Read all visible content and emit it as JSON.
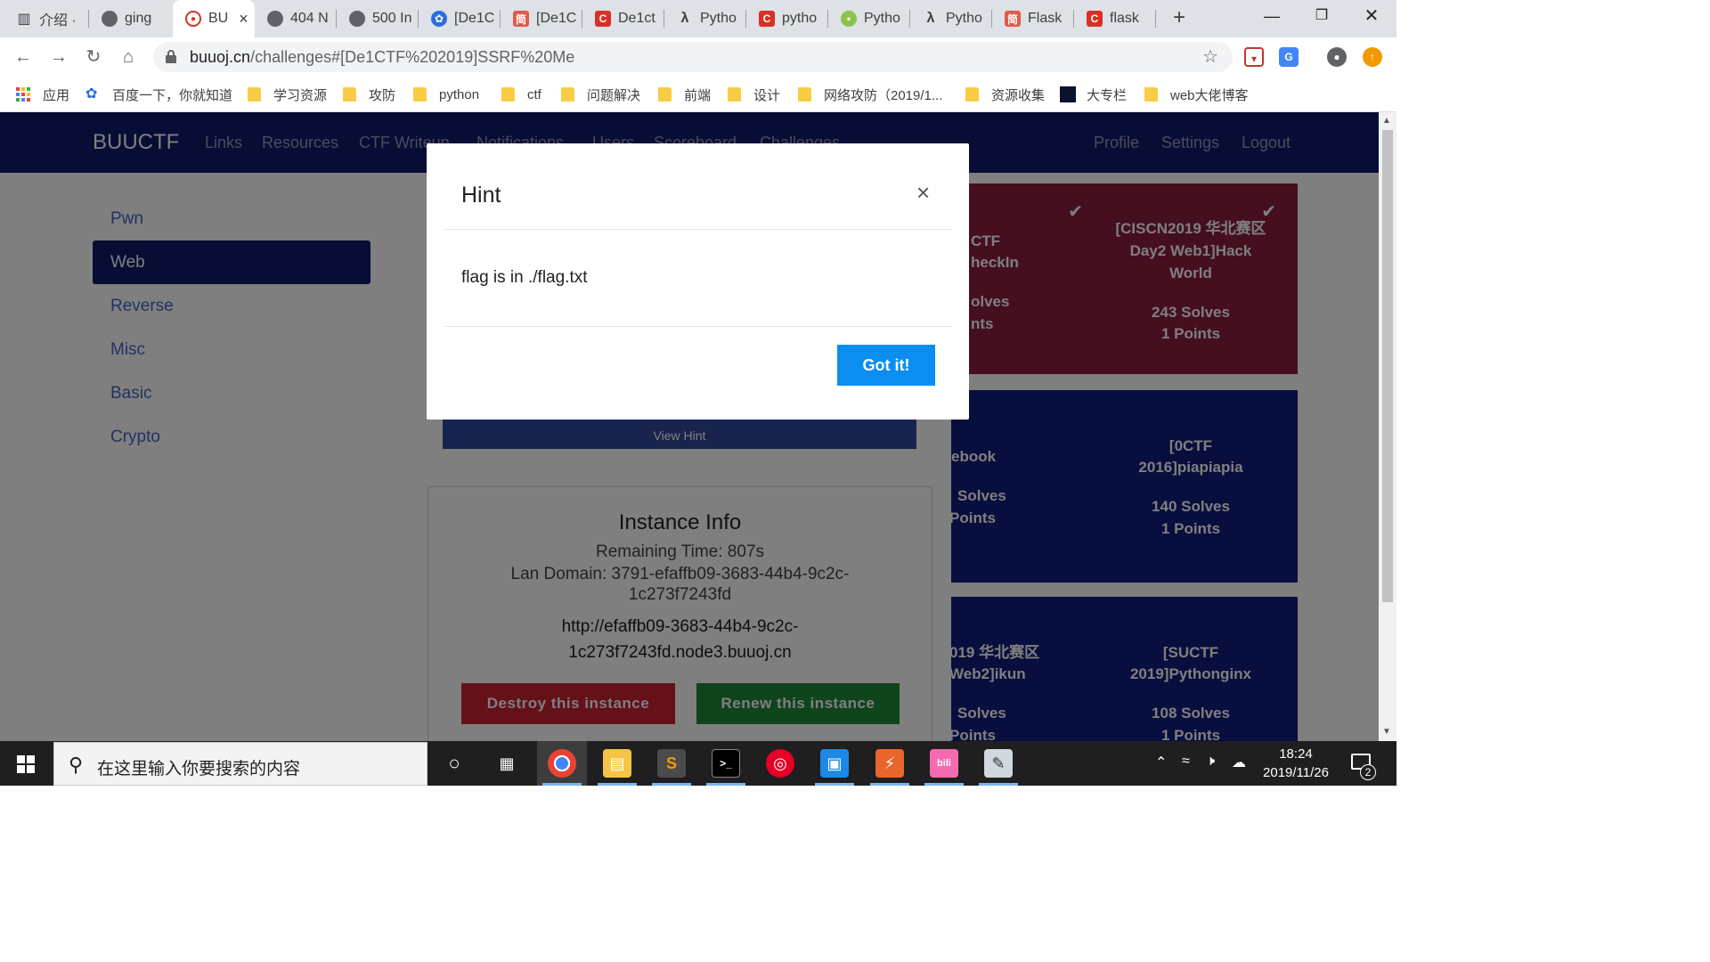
{
  "browser": {
    "tabs": [
      {
        "label": "介绍 ·",
        "icon": "book-icon"
      },
      {
        "label": "ging",
        "icon": "globe-icon"
      },
      {
        "label": "BU",
        "icon": "buuctf-icon",
        "active": true
      },
      {
        "label": "404 N",
        "icon": "globe-icon"
      },
      {
        "label": "500 In",
        "icon": "globe-icon"
      },
      {
        "label": "[De1C",
        "icon": "baidu-icon"
      },
      {
        "label": "[De1C",
        "icon": "jianshu-icon"
      },
      {
        "label": "De1ct",
        "icon": "csdn-icon"
      },
      {
        "label": "Pytho",
        "icon": "lambda-icon"
      },
      {
        "label": "pytho",
        "icon": "csdn-icon"
      },
      {
        "label": "Pytho",
        "icon": "chat-icon"
      },
      {
        "label": "Pytho",
        "icon": "lambda-icon"
      },
      {
        "label": "Flask",
        "icon": "jianshu-icon"
      },
      {
        "label": "flask",
        "icon": "csdn-icon"
      }
    ],
    "tab_close": "×",
    "new_tab": "+",
    "url_host": "buuoj.cn",
    "url_path": "/challenges#[De1CTF%202019]SSRF%20Me",
    "bookmarks": [
      {
        "label": "应用",
        "type": "apps"
      },
      {
        "label": "百度一下，你就知道",
        "type": "baidu"
      },
      {
        "label": "学习资源",
        "type": "folder"
      },
      {
        "label": "攻防",
        "type": "folder"
      },
      {
        "label": "python",
        "type": "folder"
      },
      {
        "label": "ctf",
        "type": "folder"
      },
      {
        "label": "问题解决",
        "type": "folder"
      },
      {
        "label": "前端",
        "type": "folder"
      },
      {
        "label": "设计",
        "type": "folder"
      },
      {
        "label": "网络攻防（2019/1...",
        "type": "folder"
      },
      {
        "label": "资源收集",
        "type": "folder"
      },
      {
        "label": "大专栏",
        "type": "dark"
      },
      {
        "label": "web大佬博客",
        "type": "folder"
      }
    ]
  },
  "site": {
    "brand": "BUUCTF",
    "nav_left": [
      "Links",
      "Resources",
      "CTF Writeup",
      "Notifications",
      "Users",
      "Scoreboard",
      "Challenges"
    ],
    "nav_right": [
      "Profile",
      "Settings",
      "Logout"
    ],
    "categories": [
      {
        "label": "Pwn",
        "active": false
      },
      {
        "label": "Web",
        "active": true
      },
      {
        "label": "Reverse",
        "active": false
      },
      {
        "label": "Misc",
        "active": false
      },
      {
        "label": "Basic",
        "active": false
      },
      {
        "label": "Crypto",
        "active": false
      }
    ],
    "view_hint": "View Hint",
    "instance": {
      "title": "Instance Info",
      "remaining": "Remaining Time: 807s",
      "lan_domain_1": "Lan Domain: 3791-efaffb09-3683-44b4-9c2c-",
      "lan_domain_2": "1c273f7243fd",
      "url_1": "http://efaffb09-3683-44b4-9c2c-",
      "url_2": "1c273f7243fd.node3.buuoj.cn",
      "destroy": "Destroy this instance",
      "renew": "Renew this instance"
    },
    "cards": [
      {
        "title_1": "CTF",
        "title_2": "heckIn",
        "solves": "olves",
        "points": "nts",
        "solved": true,
        "check": "✔"
      },
      {
        "title_1": "[CISCN2019 华北赛区",
        "title_2": "Day2 Web1]Hack",
        "title_3": "World",
        "solves": "243 Solves",
        "points": "1 Points",
        "solved": true,
        "check": "✔"
      },
      {
        "title_1": "ebook",
        "solves": "Solves",
        "points": "Points",
        "solved": false
      },
      {
        "title_1": "[0CTF",
        "title_2": "2016]piapiapia",
        "solves": "140 Solves",
        "points": "1 Points",
        "solved": false
      },
      {
        "title_1": "019 华北赛区",
        "title_2": "Web2]ikun",
        "solves": "Solves",
        "points": "Points",
        "solved": false
      },
      {
        "title_1": "[SUCTF",
        "title_2": "2019]Pythonginx",
        "solves": "108 Solves",
        "points": "1 Points",
        "solved": false
      }
    ]
  },
  "modal": {
    "title": "Hint",
    "close": "×",
    "body": "flag is in ./flag.txt",
    "button": "Got it!"
  },
  "taskbar": {
    "search_placeholder": "在这里输入你要搜索的内容",
    "time": "18:24",
    "date": "2019/11/26",
    "notifications": "2"
  },
  "colors": {
    "site_nav": "#0e1a6b",
    "solved_card": "#8b1e3f",
    "open_card": "#111c7a",
    "primary_button": "#0a8ff0",
    "destroy_button": "#c82333",
    "renew_button": "#218838"
  }
}
